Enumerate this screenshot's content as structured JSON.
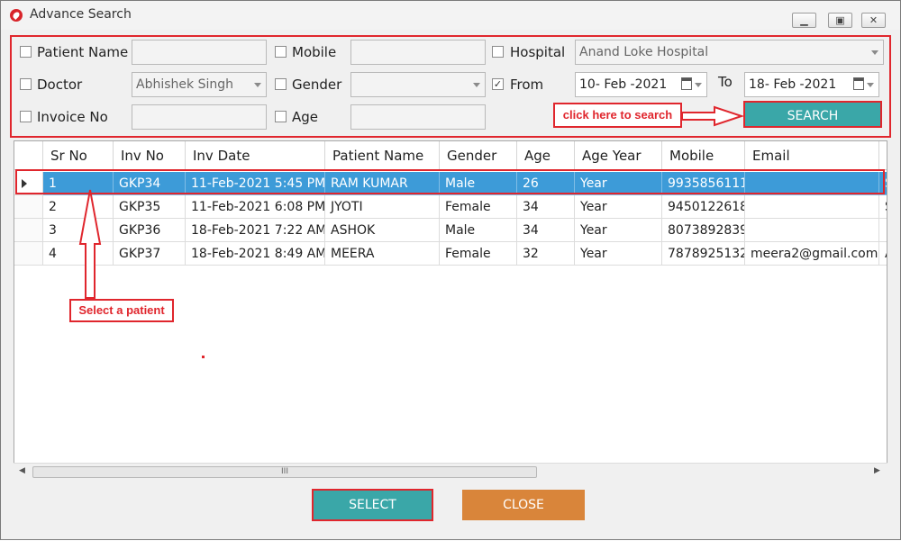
{
  "window": {
    "title": "Advance Search"
  },
  "filters": {
    "patient_name": {
      "label": "Patient Name",
      "value": ""
    },
    "mobile": {
      "label": "Mobile",
      "value": ""
    },
    "hospital": {
      "label": "Hospital",
      "value": "Anand Loke Hospital"
    },
    "doctor": {
      "label": "Doctor",
      "value": "Abhishek Singh"
    },
    "gender": {
      "label": "Gender",
      "value": ""
    },
    "from": {
      "label": "From",
      "checked": "✓",
      "value": "10- Feb -2021"
    },
    "to": {
      "label": "To",
      "value": "18- Feb -2021"
    },
    "invoice_no": {
      "label": "Invoice No",
      "value": ""
    },
    "age": {
      "label": "Age",
      "value": ""
    }
  },
  "buttons": {
    "search": "SEARCH",
    "select": "SELECT",
    "close": "CLOSE"
  },
  "annotations": {
    "search_hint": "click here to search",
    "select_hint": "Select a patient"
  },
  "grid": {
    "columns": [
      "Sr No",
      "Inv No",
      "Inv Date",
      "Patient Name",
      "Gender",
      "Age",
      "Age Year",
      "Mobile",
      "Email",
      "D"
    ],
    "rows": [
      [
        "1",
        "GKP34",
        "11-Feb-2021 5:45 PM",
        "RAM KUMAR",
        "Male",
        "26",
        "Year",
        "9935856111",
        "",
        "S"
      ],
      [
        "2",
        "GKP35",
        "11-Feb-2021 6:08 PM",
        "JYOTI",
        "Female",
        "34",
        "Year",
        "9450122618",
        "",
        "S"
      ],
      [
        "3",
        "GKP36",
        "18-Feb-2021 7:22 AM",
        "ASHOK",
        "Male",
        "34",
        "Year",
        "8073892839",
        "",
        ""
      ],
      [
        "4",
        "GKP37",
        "18-Feb-2021 8:49 AM",
        "MEERA",
        "Female",
        "32",
        "Year",
        "7878925132",
        "meera2@gmail.com",
        "A"
      ]
    ],
    "scroll_thumb_grip": "III"
  },
  "colors": {
    "teal_button": "#3aa7a8",
    "orange_button": "#d9853a",
    "selection": "#3d9bd8",
    "annotation_red": "#e0262d"
  }
}
